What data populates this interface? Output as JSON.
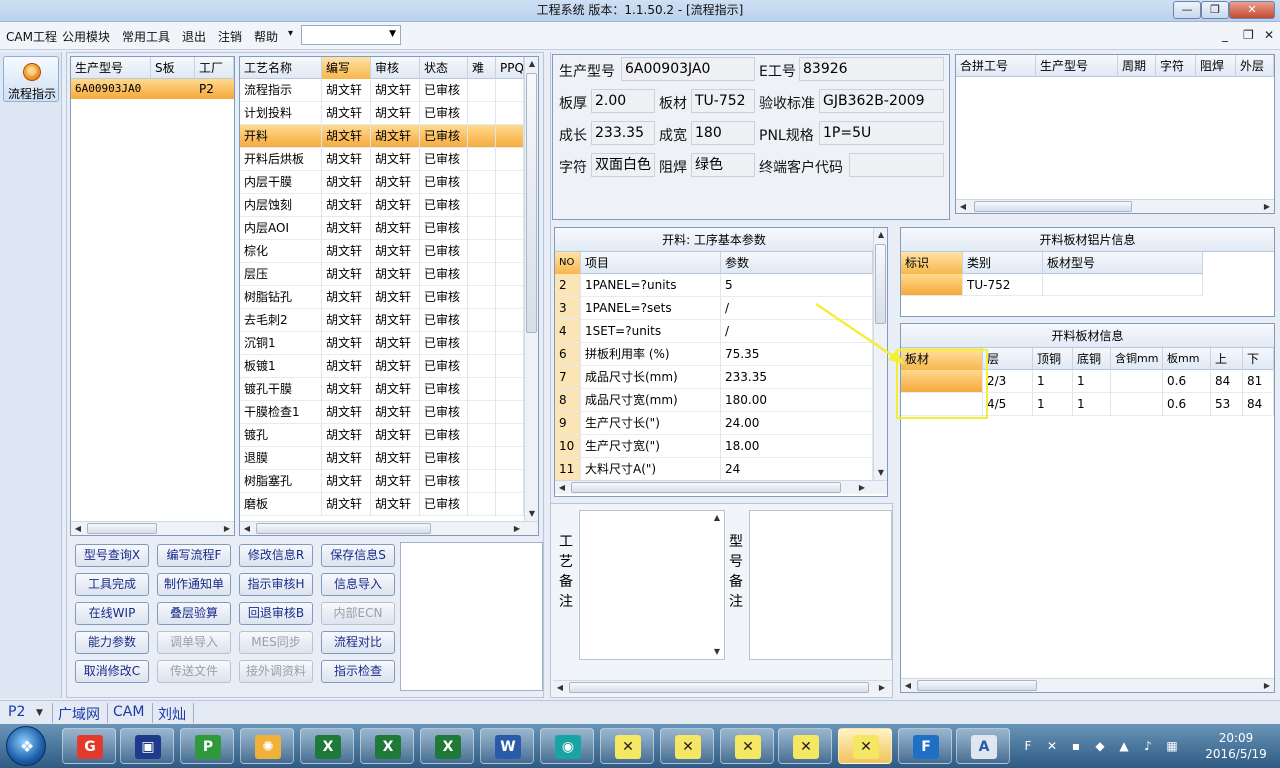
{
  "window": {
    "title": "工程系统  版本：1.1.50.2 - [流程指示]",
    "min": "—",
    "max": "❐",
    "close": "✕"
  },
  "menu": {
    "items": [
      "CAM工程",
      "公用模块",
      "常用工具",
      "退出",
      "注销",
      "帮助"
    ],
    "help_arrow": "▾",
    "combo_value": "",
    "mdi": [
      "_",
      "❐",
      "✕"
    ]
  },
  "nav": {
    "label": "流程指示"
  },
  "model_grid": {
    "headers": [
      "生产型号",
      "S板",
      "工厂"
    ],
    "rows": [
      [
        "6A00903JA0",
        "",
        "P2"
      ]
    ]
  },
  "process_grid": {
    "headers": [
      "工艺名称",
      "编写",
      "审核",
      "状态",
      "难",
      "PPQE"
    ],
    "rows": [
      [
        "流程指示",
        "胡文轩",
        "胡文轩",
        "已审核"
      ],
      [
        "计划投料",
        "胡文轩",
        "胡文轩",
        "已审核"
      ],
      [
        "开料",
        "胡文轩",
        "胡文轩",
        "已审核"
      ],
      [
        "开料后烘板",
        "胡文轩",
        "胡文轩",
        "已审核"
      ],
      [
        "内层干膜",
        "胡文轩",
        "胡文轩",
        "已审核"
      ],
      [
        "内层蚀刻",
        "胡文轩",
        "胡文轩",
        "已审核"
      ],
      [
        "内层AOI",
        "胡文轩",
        "胡文轩",
        "已审核"
      ],
      [
        "棕化",
        "胡文轩",
        "胡文轩",
        "已审核"
      ],
      [
        "层压",
        "胡文轩",
        "胡文轩",
        "已审核"
      ],
      [
        "树脂钻孔",
        "胡文轩",
        "胡文轩",
        "已审核"
      ],
      [
        "去毛刺2",
        "胡文轩",
        "胡文轩",
        "已审核"
      ],
      [
        "沉铜1",
        "胡文轩",
        "胡文轩",
        "已审核"
      ],
      [
        "板镀1",
        "胡文轩",
        "胡文轩",
        "已审核"
      ],
      [
        "镀孔干膜",
        "胡文轩",
        "胡文轩",
        "已审核"
      ],
      [
        "干膜检查1",
        "胡文轩",
        "胡文轩",
        "已审核"
      ],
      [
        "镀孔",
        "胡文轩",
        "胡文轩",
        "已审核"
      ],
      [
        "退膜",
        "胡文轩",
        "胡文轩",
        "已审核"
      ],
      [
        "树脂塞孔",
        "胡文轩",
        "胡文轩",
        "已审核"
      ],
      [
        "磨板",
        "胡文轩",
        "胡文轩",
        "已审核"
      ]
    ]
  },
  "buttons": [
    {
      "label": "型号查询X",
      "enabled": true
    },
    {
      "label": "编写流程F",
      "enabled": true
    },
    {
      "label": "修改信息R",
      "enabled": true
    },
    {
      "label": "保存信息S",
      "enabled": true
    },
    {
      "label": "工具完成",
      "enabled": true
    },
    {
      "label": "制作通知单",
      "enabled": true
    },
    {
      "label": "指示审核H",
      "enabled": true
    },
    {
      "label": "信息导入",
      "enabled": true
    },
    {
      "label": "在线WIP",
      "enabled": true
    },
    {
      "label": "叠层验算",
      "enabled": true
    },
    {
      "label": "回退审核B",
      "enabled": true
    },
    {
      "label": "内部ECN",
      "enabled": false
    },
    {
      "label": "能力参数",
      "enabled": true
    },
    {
      "label": "调单导入",
      "enabled": false
    },
    {
      "label": "MES同步",
      "enabled": false
    },
    {
      "label": "流程对比",
      "enabled": true
    },
    {
      "label": "取消修改C",
      "enabled": true
    },
    {
      "label": "传送文件",
      "enabled": false
    },
    {
      "label": "接外调资料",
      "enabled": false
    },
    {
      "label": "指示检查",
      "enabled": true
    }
  ],
  "info": {
    "model_label": "生产型号",
    "model_value": "6A00903JA0",
    "eno_label": "E工号",
    "eno_value": "83926",
    "thick_label": "板厚",
    "thick_value": "2.00",
    "mat_label": "板材",
    "mat_value": "TU-752",
    "std_label": "验收标准",
    "std_value": "GJB362B-2009",
    "len_label": "成长",
    "len_value": "233.35",
    "wid_label": "成宽",
    "wid_value": "180",
    "pnl_label": "PNL规格",
    "pnl_value": "1P=5U",
    "char_label": "字符",
    "char_value": "双面白色",
    "mask_label": "阻焊",
    "mask_value": "绿色",
    "cust_label": "终端客户代码",
    "cust_value": ""
  },
  "merge_grid": {
    "headers": [
      "合拼工号",
      "生产型号",
      "周期",
      "字符",
      "阻焊",
      "外层"
    ]
  },
  "param": {
    "title": "开料: 工序基本参数",
    "headers": [
      "NO",
      "项目",
      "参数"
    ],
    "rows": [
      [
        "2",
        "1PANEL=?units",
        "5"
      ],
      [
        "3",
        "1PANEL=?sets",
        "/"
      ],
      [
        "4",
        "1SET=?units",
        "/"
      ],
      [
        "6",
        "拼板利用率 (%)",
        "75.35"
      ],
      [
        "7",
        "成品尺寸长(mm)",
        "233.35"
      ],
      [
        "8",
        "成品尺寸宽(mm)",
        "180.00"
      ],
      [
        "9",
        "生产尺寸长(\")",
        "24.00"
      ],
      [
        "10",
        "生产尺寸宽(\")",
        "18.00"
      ],
      [
        "11",
        "大料尺寸A(\")",
        "24"
      ]
    ]
  },
  "alu": {
    "title": "开料板材铝片信息",
    "headers": [
      "标识",
      "类别",
      "板材型号"
    ],
    "rows": [
      [
        "",
        "TU-752",
        ""
      ]
    ]
  },
  "board": {
    "title": "开料板材信息",
    "headers": [
      "板材",
      "层",
      "顶铜",
      "底铜",
      "含铜mm",
      "板mm",
      "上",
      "下"
    ],
    "rows": [
      [
        "",
        "2/3",
        "1",
        "1",
        "",
        "0.6",
        "84",
        "81"
      ],
      [
        "",
        "4/5",
        "1",
        "1",
        "",
        "0.6",
        "53",
        "84"
      ]
    ]
  },
  "remarks": {
    "craft": "工艺备注",
    "model": "型号备注"
  },
  "status": {
    "factory": "P2",
    "net": "广域网",
    "dept": "CAM",
    "user": "刘灿"
  },
  "taskbar": {
    "time": "20:09",
    "date": "2016/5/19"
  },
  "colors": {
    "accent": "#f6a93b",
    "annotation": "#f3ef34"
  }
}
